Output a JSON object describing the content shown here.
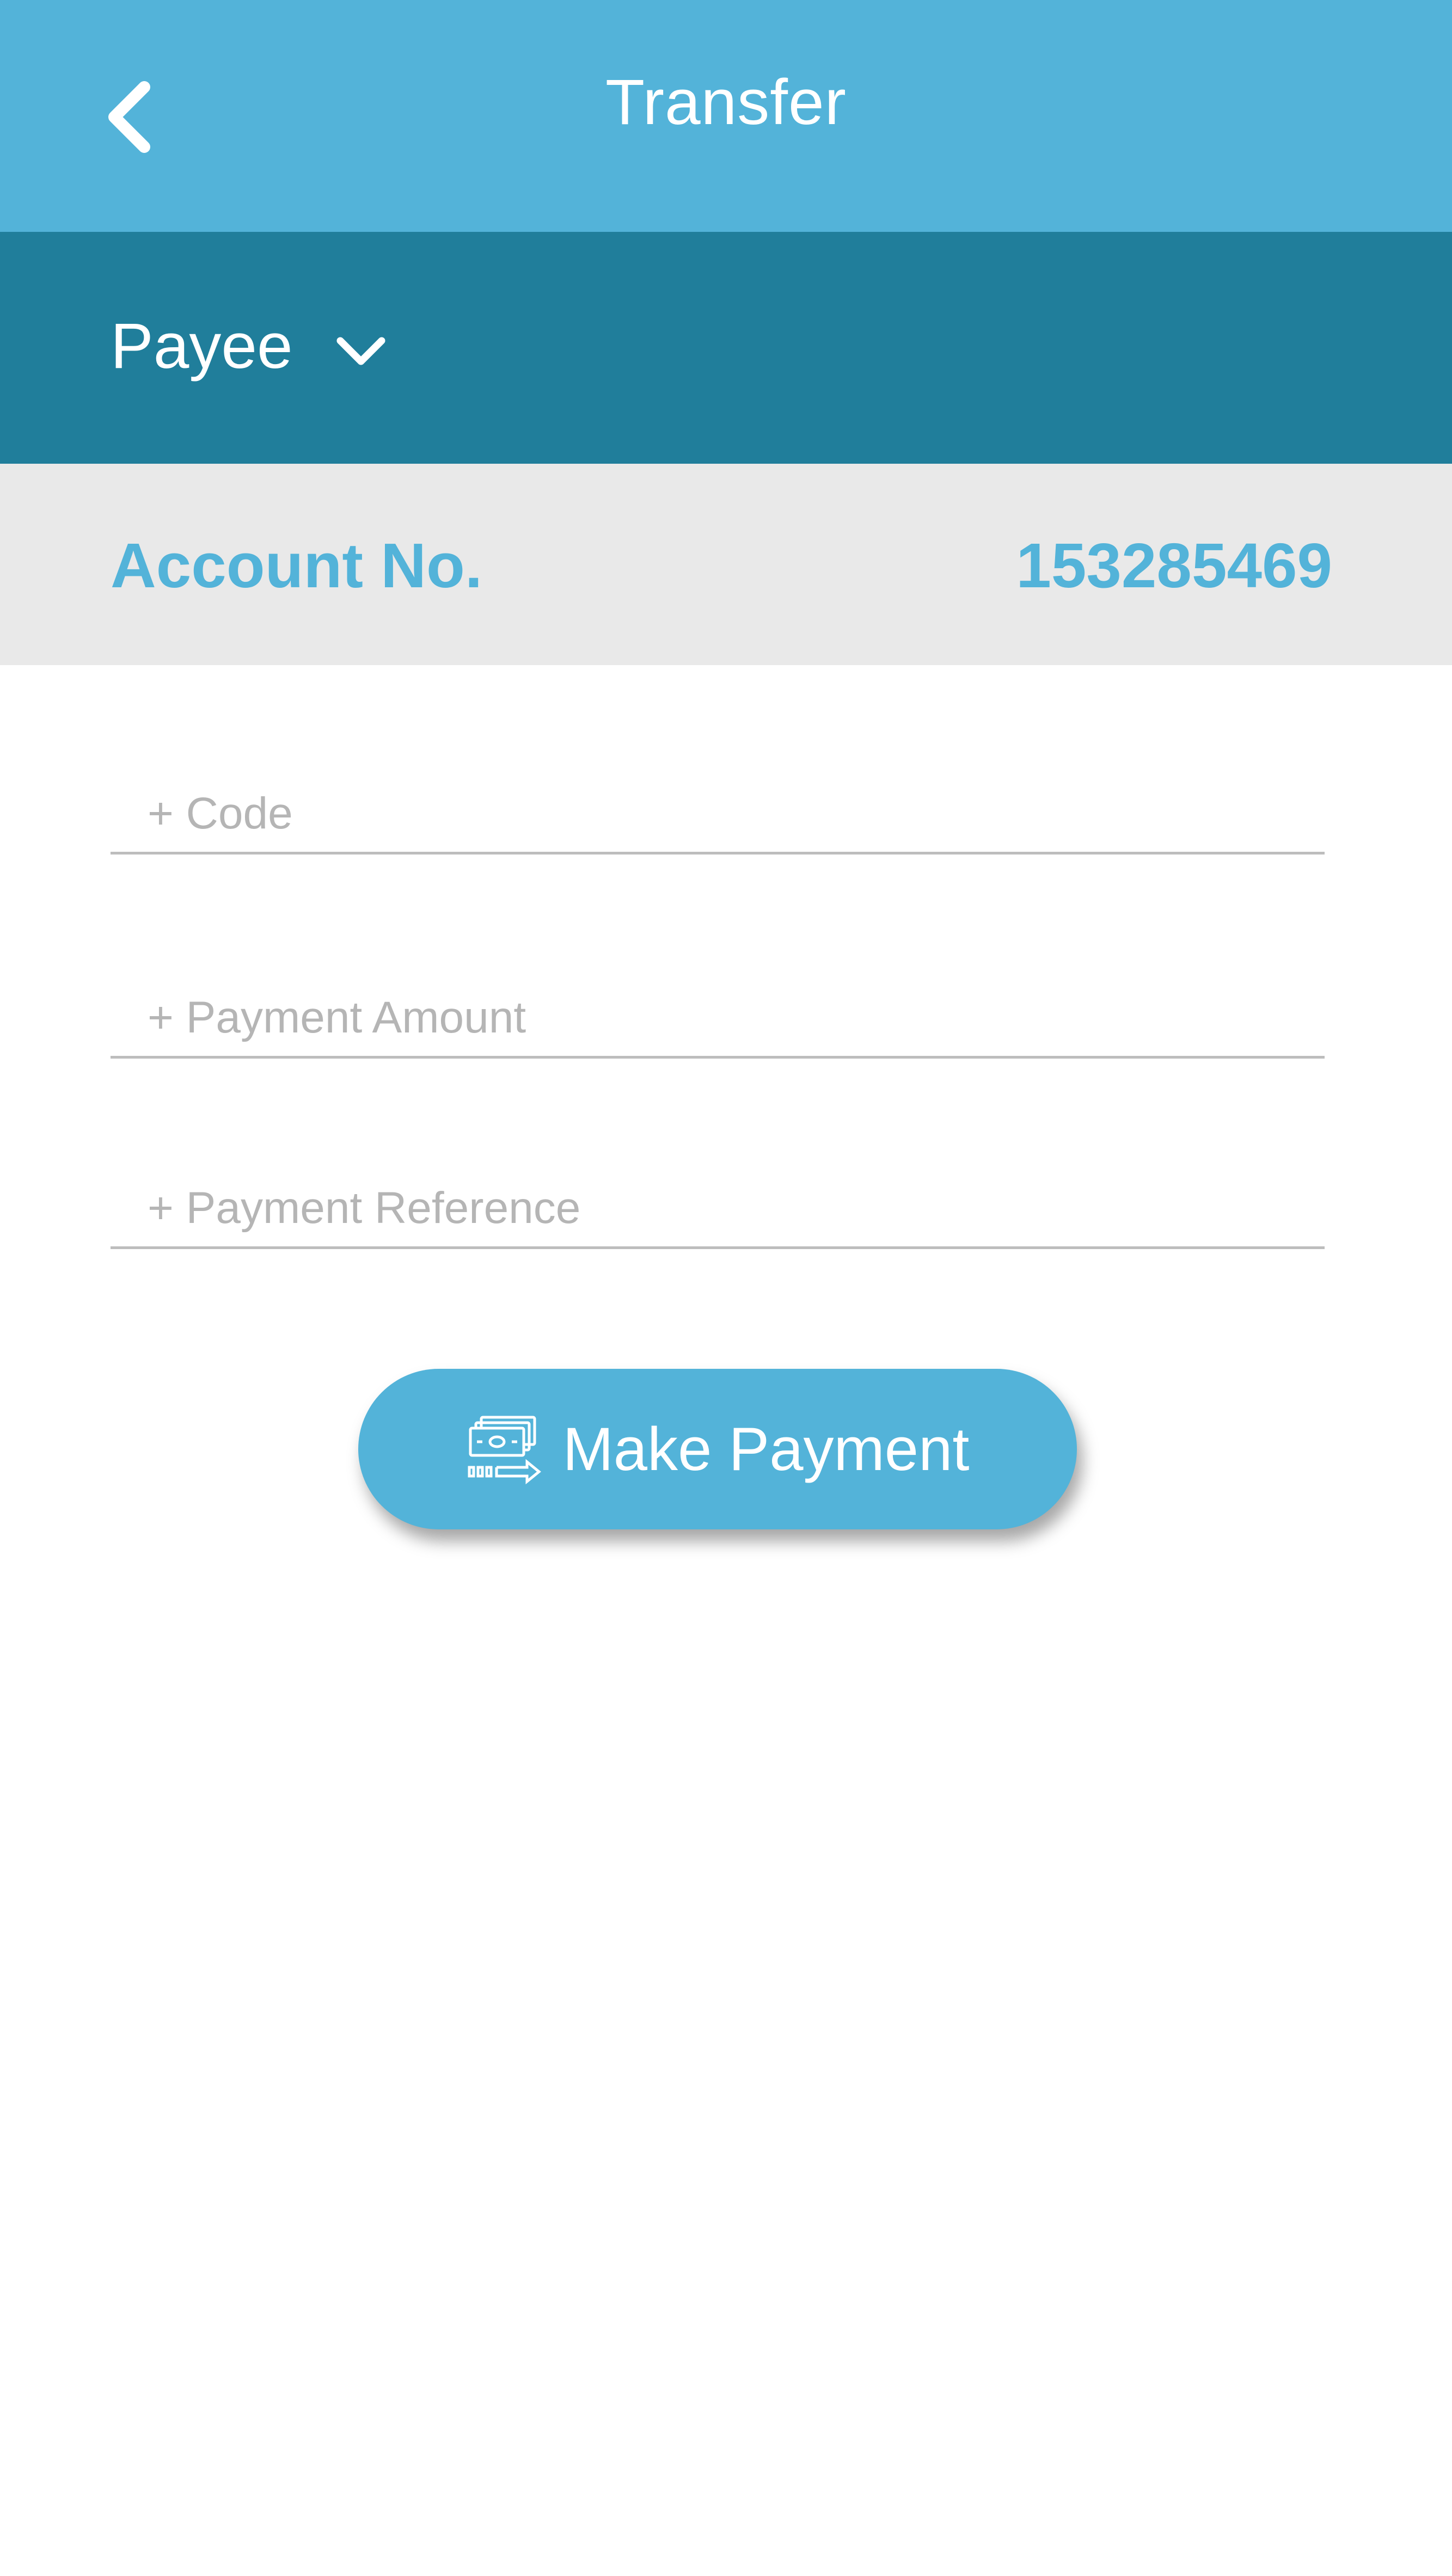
{
  "header": {
    "title": "Transfer",
    "back_icon": "back-arrow-icon",
    "color": "#53b3d9"
  },
  "payee": {
    "label": "Payee",
    "dropdown_icon": "chevron-down-icon",
    "color": "#207e9b"
  },
  "account": {
    "label": "Account No.",
    "number": "153285469",
    "accent": "#53b3d9"
  },
  "form": {
    "code_placeholder": "+ Code",
    "amount_placeholder": "+ Payment Amount",
    "reference_placeholder": "+ Payment Reference"
  },
  "actions": {
    "make_payment_label": "Make Payment",
    "make_payment_icon": "money-transfer-icon"
  }
}
